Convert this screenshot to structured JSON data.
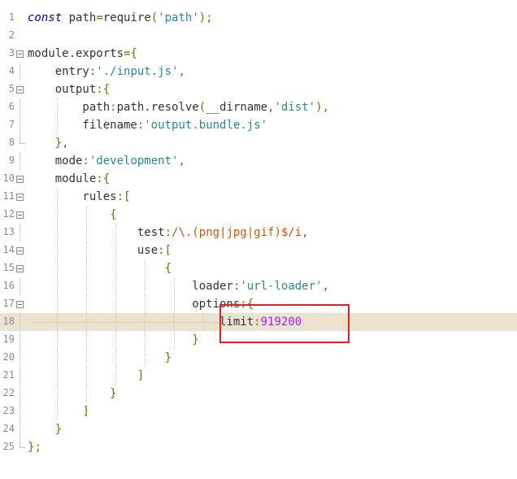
{
  "editor": {
    "lines": [
      {
        "num": "1",
        "text": "const path=require('path');"
      },
      {
        "num": "2",
        "text": ""
      },
      {
        "num": "3",
        "text": "module.exports={"
      },
      {
        "num": "4",
        "text": "    entry:'./input.js',"
      },
      {
        "num": "5",
        "text": "    output:{"
      },
      {
        "num": "6",
        "text": "        path:path.resolve(__dirname,'dist'),"
      },
      {
        "num": "7",
        "text": "        filename:'output.bundle.js'"
      },
      {
        "num": "8",
        "text": "    },"
      },
      {
        "num": "9",
        "text": "    mode:'development',"
      },
      {
        "num": "10",
        "text": "    module:{"
      },
      {
        "num": "11",
        "text": "        rules:["
      },
      {
        "num": "12",
        "text": "            {"
      },
      {
        "num": "13",
        "text": "                test:/\\.(png|jpg|gif)$/i,"
      },
      {
        "num": "14",
        "text": "                use:["
      },
      {
        "num": "15",
        "text": "                    {"
      },
      {
        "num": "16",
        "text": "                        loader:'url-loader',"
      },
      {
        "num": "17",
        "text": "                        options:{"
      },
      {
        "num": "18",
        "text": "                            limit:919200"
      },
      {
        "num": "19",
        "text": "                        }"
      },
      {
        "num": "20",
        "text": "                    }"
      },
      {
        "num": "21",
        "text": "                ]"
      },
      {
        "num": "22",
        "text": "            }"
      },
      {
        "num": "23",
        "text": "        ]"
      },
      {
        "num": "24",
        "text": "    }"
      },
      {
        "num": "25",
        "text": "};"
      }
    ],
    "highlighted_line": "18",
    "colors": {
      "keyword": "#0000a8",
      "string": "#2a8a8a",
      "number": "#a020f0",
      "regex": "#d35400",
      "highlight_bg": "#ebe3d0",
      "annotation_box": "#e02020"
    }
  }
}
